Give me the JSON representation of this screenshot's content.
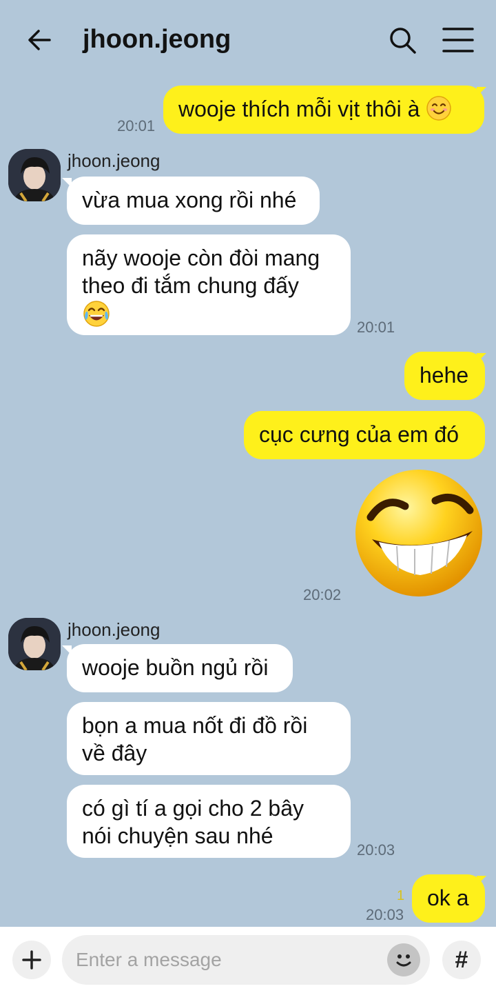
{
  "header": {
    "title": "jhoon.jeong"
  },
  "messages": [
    {
      "text": "wooje thích mỗi vịt thôi à",
      "time": "20:01"
    },
    {
      "sender": "jhoon.jeong",
      "text": "vừa mua xong rồi nhé"
    },
    {
      "line1": "nãy wooje còn đòi mang",
      "line2": "theo đi tắm chung đấy",
      "time": "20:01"
    },
    {
      "text": "hehe"
    },
    {
      "text": "cục cưng của em đó",
      "time": "20:02"
    },
    {
      "sender": "jhoon.jeong",
      "text": "wooje buồn ngủ rồi"
    },
    {
      "line1": "bọn a mua nốt đi đồ rồi",
      "line2": "về đây"
    },
    {
      "line1": "có gì tí a gọi cho 2 bây",
      "line2": "nói chuyện sau nhé",
      "time": "20:03"
    },
    {
      "text": "ok a",
      "time": "20:03",
      "unread": "1"
    }
  ],
  "composer": {
    "placeholder": "Enter a message",
    "hash_label": "#"
  },
  "colors": {
    "background": "#b2c7d9",
    "my_bubble": "#fef01b",
    "their_bubble": "#ffffff"
  },
  "icons": [
    "back-arrow-icon",
    "search-icon",
    "menu-icon",
    "plus-icon",
    "emoji-icon",
    "hashtag-icon"
  ]
}
